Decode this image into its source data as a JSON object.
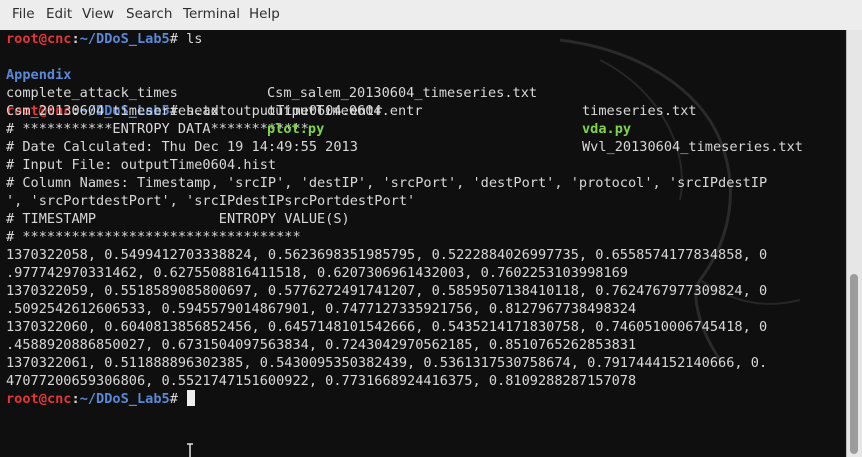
{
  "menu": [
    "File",
    "Edit",
    "View",
    "Search",
    "Terminal",
    "Help"
  ],
  "prompt": {
    "user": "root",
    "at": "@",
    "host": "cnc",
    "sep": ":",
    "path": "~/DDoS_Lab5",
    "hash": "# "
  },
  "commands": {
    "ls": "ls",
    "head": "head outputTime0604.entr"
  },
  "ls_output": {
    "row1": [
      "Appendix",
      "Csm_salem_20130604_timeseries.txt",
      "timeseries.txt"
    ],
    "row2": [
      "complete_attack_times",
      "outputTime0604.entr",
      "vda.py"
    ],
    "row3": [
      "Csm_20130604_timeseries.txt",
      "plot.py",
      "Wvl_20130604_timeseries.txt"
    ]
  },
  "head_output": [
    "# ***********ENTROPY DATA************",
    "# Date Calculated: Thu Dec 19 14:49:55 2013",
    "# Input File: outputTime0604.hist",
    "# Column Names: Timestamp, 'srcIP', 'destIP', 'srcPort', 'destPort', 'protocol', 'srcIPdestIP",
    "', 'srcPortdestPort', 'srcIPdestIPsrcPortdestPort'",
    "# TIMESTAMP               ENTROPY VALUE(S)",
    "# **********************************",
    "1370322058, 0.5499412703338824, 0.5623698351985795, 0.5222884026997735, 0.6558574177834858, 0",
    ".977742970331462, 0.6275508816411518, 0.6207306961432003, 0.7602253103998169",
    "1370322059, 0.5518589085800697, 0.5776272491741207, 0.5859507138410118, 0.7624767977309824, 0",
    ".5092542612606533, 0.5945579014867901, 0.7477127335921756, 0.8127967738498324",
    "1370322060, 0.6040813856852456, 0.6457148101542666, 0.5435214171830758, 0.7460510006745418, 0",
    ".4588920886850027, 0.6731504097563834, 0.7243042970562185, 0.8510765262853831",
    "1370322061, 0.511888896302385, 0.5430095350382439, 0.5361317530758674, 0.7917444152140666, 0.",
    "47077200659306806, 0.5521747151600922, 0.7731668924416375, 0.8109288287157078"
  ]
}
